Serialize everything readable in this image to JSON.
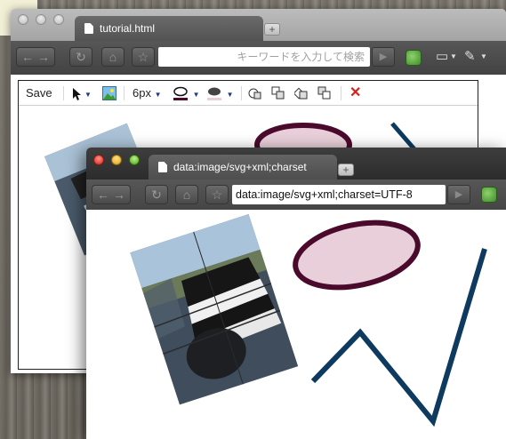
{
  "back_window": {
    "tab_title": "tutorial.html",
    "address_placeholder": "キーワードを入力して検索",
    "go_label": "▶",
    "editor_toolbar": {
      "save_label": "Save",
      "stroke_width_label": "6px",
      "dropdown_caret": "▼",
      "delete_label": "✕"
    }
  },
  "front_window": {
    "tab_title": "data:image/svg+xml;charset",
    "address_value": "data:image/svg+xml;charset=UTF-8"
  },
  "icons": {
    "back": "←",
    "forward": "→",
    "reload": "↻",
    "home": "⌂",
    "bookmark": "☆",
    "new_tab": "+",
    "page_menu": "▭",
    "wrench": "✎"
  },
  "colors": {
    "ellipse_fill": "#e8cfd9",
    "ellipse_stroke": "#4a0a2c",
    "polyline_stroke": "#0d3a5e",
    "delete_red": "#d32020"
  }
}
